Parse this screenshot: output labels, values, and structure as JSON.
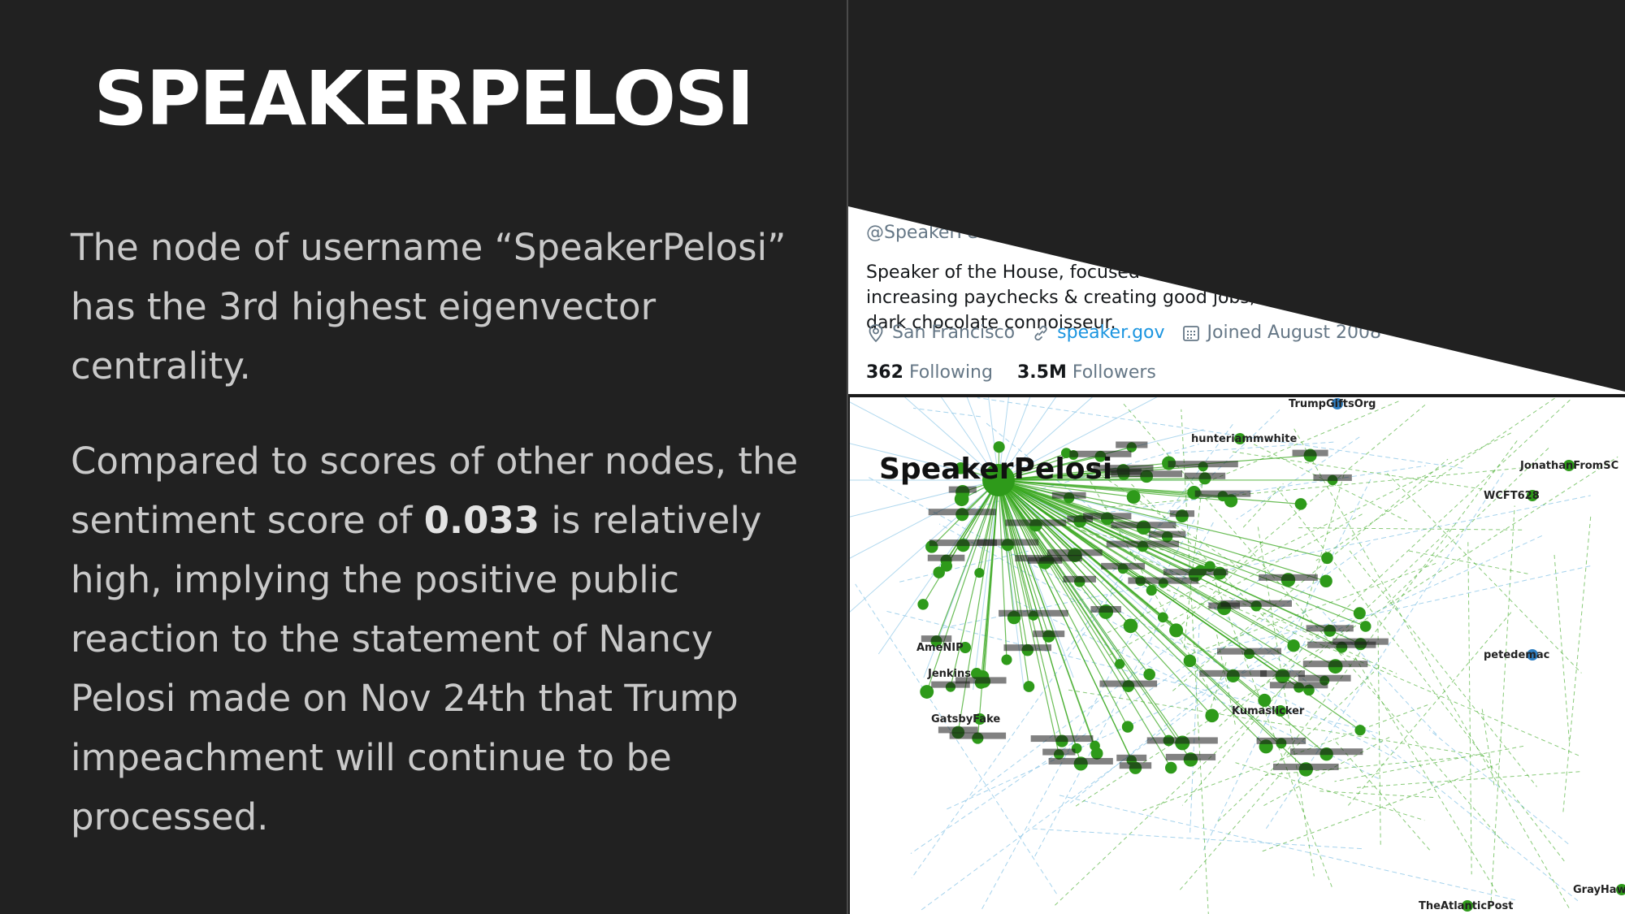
{
  "slide": {
    "title": "SPEAKERPELOSI",
    "paragraph1": "The node of username “SpeakerPelosi” has the 3rd highest eigenvector centrality.",
    "paragraph2_before": "Compared to scores of other nodes, the sentiment score of ",
    "paragraph2_score": "0.033",
    "paragraph2_after": " is relatively high, implying the positive public reaction to the statement of Nancy Pelosi made on Nov 24th that Trump impeachment will continue to be processed."
  },
  "profile": {
    "handle": "@SpeakerPelosi",
    "bio": "Speaker of the House, focused on lowering health care costs, increasing paychecks & creating good jobs; mother, grandmother, dark chocolate connoisseur.",
    "location": "San Francisco",
    "website": "speaker.gov",
    "joined": "Joined August 2008",
    "following_count": "362",
    "following_label": "Following",
    "followers_count": "3.5M",
    "followers_label": "Followers",
    "icons": [
      "location-pin-icon",
      "link-icon",
      "calendar-icon"
    ]
  },
  "graph": {
    "main_label": "SpeakerPelosi",
    "colors": {
      "edge_green": "#3aa820",
      "edge_blue": "#8fc8e8",
      "node_green": "#2e9a1a",
      "node_blue": "#2f7fc2"
    },
    "node_labels": [
      "TrumpGiftsOrg",
      "JonathanFromSC",
      "WCFT628",
      "petedemac",
      "GrayHawk",
      "TheAtlanticPost",
      "Kumaslicker",
      "AmeNIP",
      "GatsbyFake",
      "Jenkins",
      "hunteriammwhite"
    ]
  }
}
